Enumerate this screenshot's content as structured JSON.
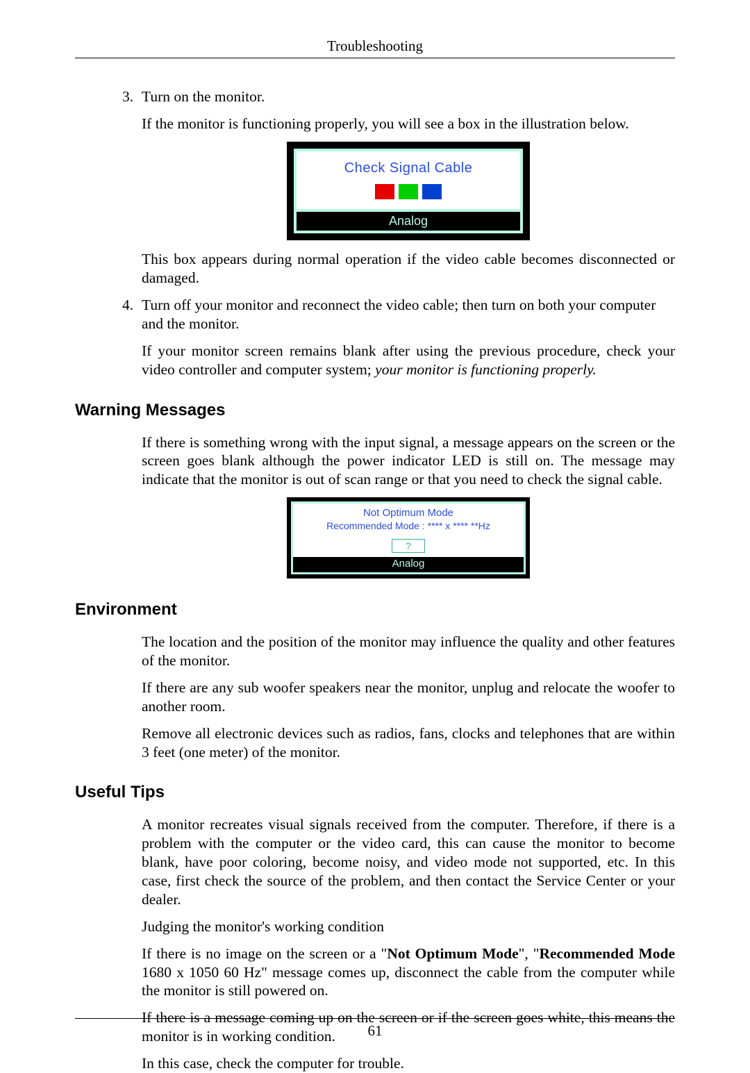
{
  "header": {
    "title": "Troubleshooting"
  },
  "footer": {
    "page_number": "61"
  },
  "list": {
    "n3": "3.",
    "n4": "4.",
    "item3_title": "Turn on the monitor.",
    "item3_body": "If the monitor is functioning properly, you will see a box in the illustration below.",
    "item3_after": "This box appears during normal operation if the video cable becomes disconnected or damaged.",
    "item4_body": "Turn off your monitor and reconnect the video cable; then turn on both your computer and the monitor."
  },
  "after_list_plain": "If your monitor screen remains blank after using the previous procedure, check your video controller and computer system; ",
  "after_list_italic": "your monitor is functioning properly.",
  "fig1": {
    "title": "Check Signal Cable",
    "footer": "Analog"
  },
  "fig2": {
    "line1": "Not Optimum Mode",
    "line2": "Recommended Mode : **** x ****  **Hz",
    "btn": "?",
    "footer": "Analog"
  },
  "warning": {
    "heading": "Warning Messages",
    "body": "If there is something wrong with the input signal, a message appears on the screen or the screen goes blank although the power indicator LED is still on. The message may indicate that the monitor is out of scan range or that you need to check the signal cable."
  },
  "environment": {
    "heading": "Environment",
    "p1": "The location and the position of the monitor may influence the quality and other features of the monitor.",
    "p2": "If there are any sub woofer speakers near the monitor, unplug and relocate the woofer to another room.",
    "p3": "Remove all electronic devices such as radios, fans, clocks and telephones that are within 3 feet (one meter) of the monitor."
  },
  "tips": {
    "heading": "Useful Tips",
    "p1": "A monitor recreates visual signals received from the computer. Therefore, if there is a problem with the computer or the video card, this can cause the monitor to become blank, have poor coloring, become noisy, and video mode not supported, etc. In this case, first check the source of the problem, and then contact the Service Center or your dealer.",
    "p2": "Judging the monitor's working condition",
    "p3_a": "If there is no image on the screen or a \"",
    "p3_b": "Not Optimum Mode",
    "p3_c": "\", \"",
    "p3_d": "Recommended Mode",
    "p3_e": " 1680 x 1050 60 Hz\" message comes up, disconnect the cable from the computer while the monitor is still powered on.",
    "p4": "If there is a message coming up on the screen or if the screen goes white, this means the monitor is in working condition.",
    "p5": "In this case, check the computer for trouble."
  }
}
